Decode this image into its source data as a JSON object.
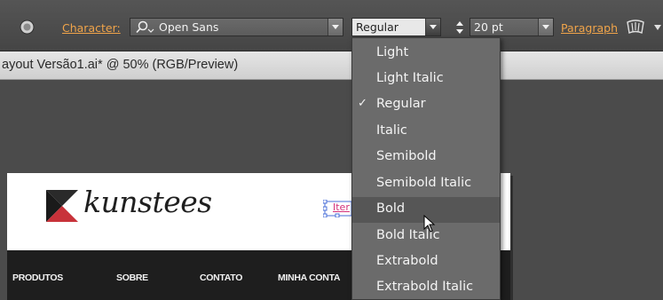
{
  "control_bar": {
    "character_label": "Character:",
    "font_family": "Open Sans",
    "font_style": "Regular",
    "font_size": "20 pt",
    "paragraph_label": "Paragraph"
  },
  "document_tab": {
    "title": "ayout Versão1.ai* @ 50% (RGB/Preview)"
  },
  "artboard": {
    "logo_text": "kunstees",
    "selected_text": "Iter",
    "nav_items": [
      "PRODUTOS",
      "SOBRE",
      "CONTATO",
      "MINHA CONTA"
    ]
  },
  "font_style_menu": {
    "items": [
      {
        "label": "Light",
        "checked": false,
        "hovered": false
      },
      {
        "label": "Light Italic",
        "checked": false,
        "hovered": false
      },
      {
        "label": "Regular",
        "checked": true,
        "hovered": false
      },
      {
        "label": "Italic",
        "checked": false,
        "hovered": false
      },
      {
        "label": "Semibold",
        "checked": false,
        "hovered": false
      },
      {
        "label": "Semibold Italic",
        "checked": false,
        "hovered": false
      },
      {
        "label": "Bold",
        "checked": false,
        "hovered": true
      },
      {
        "label": "Bold Italic",
        "checked": false,
        "hovered": false
      },
      {
        "label": "Extrabold",
        "checked": false,
        "hovered": false
      },
      {
        "label": "Extrabold Italic",
        "checked": false,
        "hovered": false
      }
    ],
    "check_glyph": "✓"
  },
  "colors": {
    "link_orange": "#f0a44a",
    "brand_red": "#c8323a",
    "navbar": "#1e1e1e"
  }
}
